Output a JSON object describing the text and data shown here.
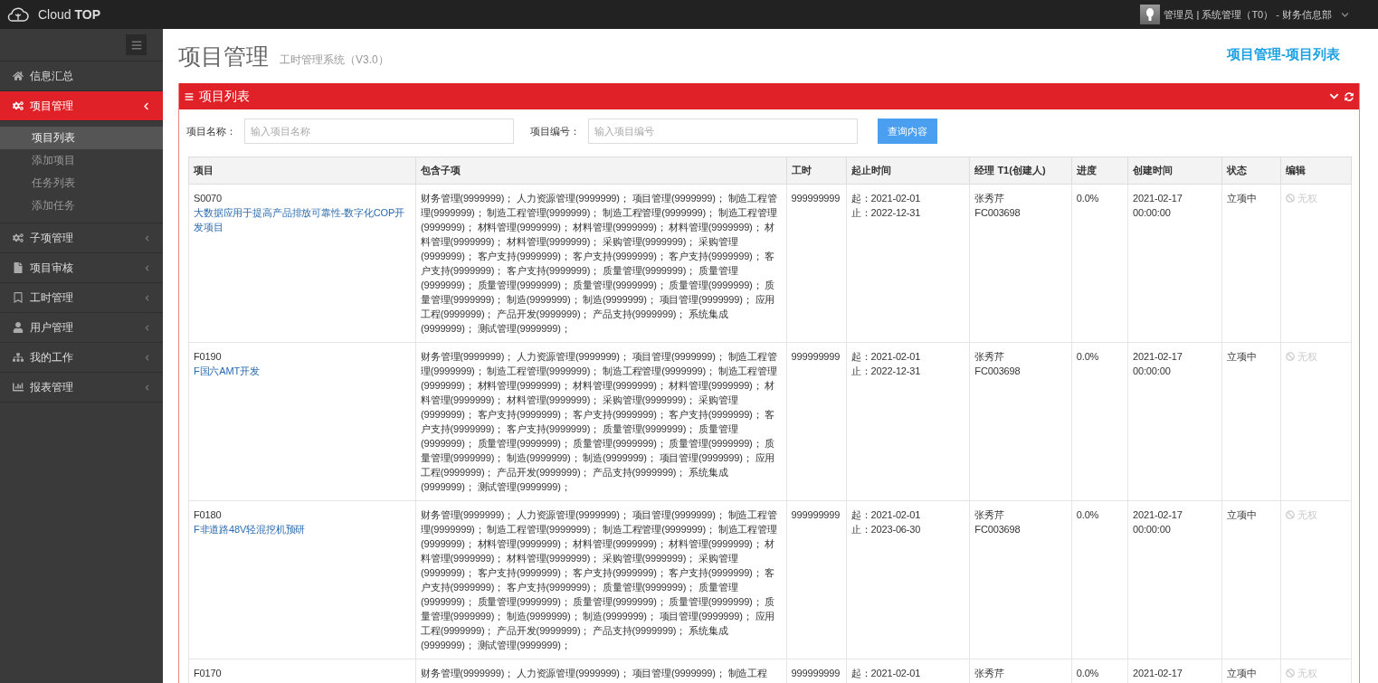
{
  "header": {
    "brand": "Cloud **TOP**",
    "user": "管理员 | 系统管理（T0） - 财务信息部"
  },
  "sidebar": {
    "items": [
      {
        "label": "信息汇总",
        "selected": false,
        "has_arrow": false
      },
      {
        "label": "项目管理",
        "selected": true,
        "has_arrow": true,
        "expanded": true,
        "children": [
          {
            "label": "项目列表",
            "selected": true
          },
          {
            "label": "添加项目",
            "selected": false
          },
          {
            "label": "任务列表",
            "selected": false
          },
          {
            "label": "添加任务",
            "selected": false
          }
        ]
      },
      {
        "label": "子项管理",
        "selected": false,
        "has_arrow": true,
        "expanded": false
      },
      {
        "label": "项目审核",
        "selected": false,
        "has_arrow": true,
        "expanded": false
      },
      {
        "label": "工时管理",
        "selected": false,
        "has_arrow": true,
        "expanded": false
      },
      {
        "label": "用户管理",
        "selected": false,
        "has_arrow": true,
        "expanded": false
      },
      {
        "label": "我的工作",
        "selected": false,
        "has_arrow": true,
        "expanded": false
      },
      {
        "label": "报表管理",
        "selected": false,
        "has_arrow": true,
        "expanded": false
      }
    ]
  },
  "page": {
    "title": "项目管理",
    "subtitle": "工时管理系统（V3.0）",
    "breadcrumb": "项目管理-项目列表"
  },
  "panel": {
    "title": "项目列表",
    "search": {
      "fields": [
        {
          "label": "项目名称：",
          "placeholder": "输入项目名称"
        },
        {
          "label": "项目编号：",
          "placeholder": "输入项目编号"
        }
      ],
      "button": "查询内容"
    },
    "table": {
      "columns": [
        "项目",
        "包含子项",
        "工时",
        "起止时间",
        "经理 T1(创建人)",
        "进度",
        "创建时间",
        "状态",
        "编辑"
      ],
      "rows": [
        {
          "code": "S0070",
          "name": "大数据应用于提高产品排放可靠性-数字化COP开发项目",
          "subitems": "财务管理(9999999)； 人力资源管理(9999999)； 项目管理(9999999)； 制造工程管理(9999999)； 制造工程管理(9999999)； 制造工程管理(9999999)； 制造工程管理(9999999)； 材料管理(9999999)； 材料管理(9999999)； 材料管理(9999999)； 材料管理(9999999)； 材料管理(9999999)； 采购管理(9999999)； 采购管理(9999999)； 客户支持(9999999)； 客户支持(9999999)； 客户支持(9999999)； 客户支持(9999999)； 客户支持(9999999)； 质量管理(9999999)； 质量管理(9999999)； 质量管理(9999999)； 质量管理(9999999)； 质量管理(9999999)； 质量管理(9999999)； 制造(9999999)； 制造(9999999)； 项目管理(9999999)； 应用工程(9999999)； 产品开发(9999999)； 产品支持(9999999)； 系统集成(9999999)； 测试管理(9999999)；",
          "hours": "999999999",
          "start": "起：2021-02-01",
          "end": "止：2022-12-31",
          "manager": "张秀芹",
          "manager_id": "FC003698",
          "progress": "0.0%",
          "created_date": "2021-02-17",
          "created_time": "00:00:00",
          "status": "立项中",
          "edit": "无权",
          "edit_disabled": true
        },
        {
          "code": "F0190",
          "name": "F国六AMT开发",
          "subitems": "财务管理(9999999)； 人力资源管理(9999999)； 项目管理(9999999)； 制造工程管理(9999999)； 制造工程管理(9999999)； 制造工程管理(9999999)； 制造工程管理(9999999)； 材料管理(9999999)； 材料管理(9999999)； 材料管理(9999999)； 材料管理(9999999)； 材料管理(9999999)； 采购管理(9999999)； 采购管理(9999999)； 客户支持(9999999)； 客户支持(9999999)； 客户支持(9999999)； 客户支持(9999999)； 客户支持(9999999)； 质量管理(9999999)； 质量管理(9999999)； 质量管理(9999999)； 质量管理(9999999)； 质量管理(9999999)； 质量管理(9999999)； 制造(9999999)； 制造(9999999)； 项目管理(9999999)； 应用工程(9999999)； 产品开发(9999999)； 产品支持(9999999)； 系统集成(9999999)； 测试管理(9999999)；",
          "hours": "999999999",
          "start": "起：2021-02-01",
          "end": "止：2022-12-31",
          "manager": "张秀芹",
          "manager_id": "FC003698",
          "progress": "0.0%",
          "created_date": "2021-02-17",
          "created_time": "00:00:00",
          "status": "立项中",
          "edit": "无权",
          "edit_disabled": true
        },
        {
          "code": "F0180",
          "name": "F非道路48V轻混挖机预研",
          "subitems": "财务管理(9999999)； 人力资源管理(9999999)； 项目管理(9999999)； 制造工程管理(9999999)； 制造工程管理(9999999)； 制造工程管理(9999999)； 制造工程管理(9999999)； 材料管理(9999999)； 材料管理(9999999)； 材料管理(9999999)； 材料管理(9999999)； 材料管理(9999999)； 采购管理(9999999)； 采购管理(9999999)； 客户支持(9999999)； 客户支持(9999999)； 客户支持(9999999)； 客户支持(9999999)； 客户支持(9999999)； 质量管理(9999999)； 质量管理(9999999)； 质量管理(9999999)； 质量管理(9999999)； 质量管理(9999999)； 质量管理(9999999)； 制造(9999999)； 制造(9999999)； 项目管理(9999999)； 应用工程(9999999)； 产品开发(9999999)； 产品支持(9999999)； 系统集成(9999999)； 测试管理(9999999)；",
          "hours": "999999999",
          "start": "起：2021-02-01",
          "end": "止：2023-06-30",
          "manager": "张秀芹",
          "manager_id": "FC003698",
          "progress": "0.0%",
          "created_date": "2021-02-17",
          "created_time": "00:00:00",
          "status": "立项中",
          "edit": "无权",
          "edit_disabled": true
        },
        {
          "code": "F0170",
          "subitems": "财务管理(9999999)； 人力资源管理(9999999)； 项目管理(9999999)； 制造工程",
          "hours": "999999999",
          "start": "起：2021-02-01",
          "manager": "张秀芹",
          "progress": "0.0%",
          "created_date": "2021-02-17",
          "status": "立项中",
          "edit": "无权",
          "edit_disabled": true
        }
      ]
    }
  }
}
